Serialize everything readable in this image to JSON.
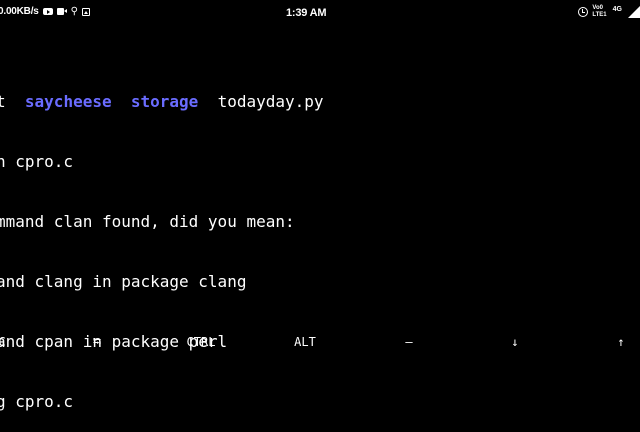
{
  "status_bar": {
    "net_speed": "0.00KB/s",
    "time": "1:39 AM",
    "volte_top": "Vo0",
    "volte_bottom": "LTE1",
    "network_type": "4G",
    "left_icons": [
      "youtube-icon",
      "video-icon",
      "usb-icon",
      "image-icon"
    ],
    "right_icons": [
      "alarm-icon",
      "signal-icon",
      "battery-icon"
    ]
  },
  "terminal": {
    "ls_line": {
      "prefix": "t",
      "dirs": [
        "saycheese",
        "storage"
      ],
      "file": "todayday.py"
    },
    "lines": [
      "n cpro.c",
      "mmand clan found, did you mean:",
      "and clang in package clang",
      "and cpan in package perl",
      "g cpro.c"
    ]
  },
  "extra_keys": {
    "esc": "C",
    "tab": "⭾",
    "ctrl": "CTRL",
    "alt": "ALT",
    "dash": "—",
    "down": "↓",
    "up": "↑"
  },
  "colors": {
    "background": "#000000",
    "text": "#ffffff",
    "directory": "#6a6cff"
  }
}
